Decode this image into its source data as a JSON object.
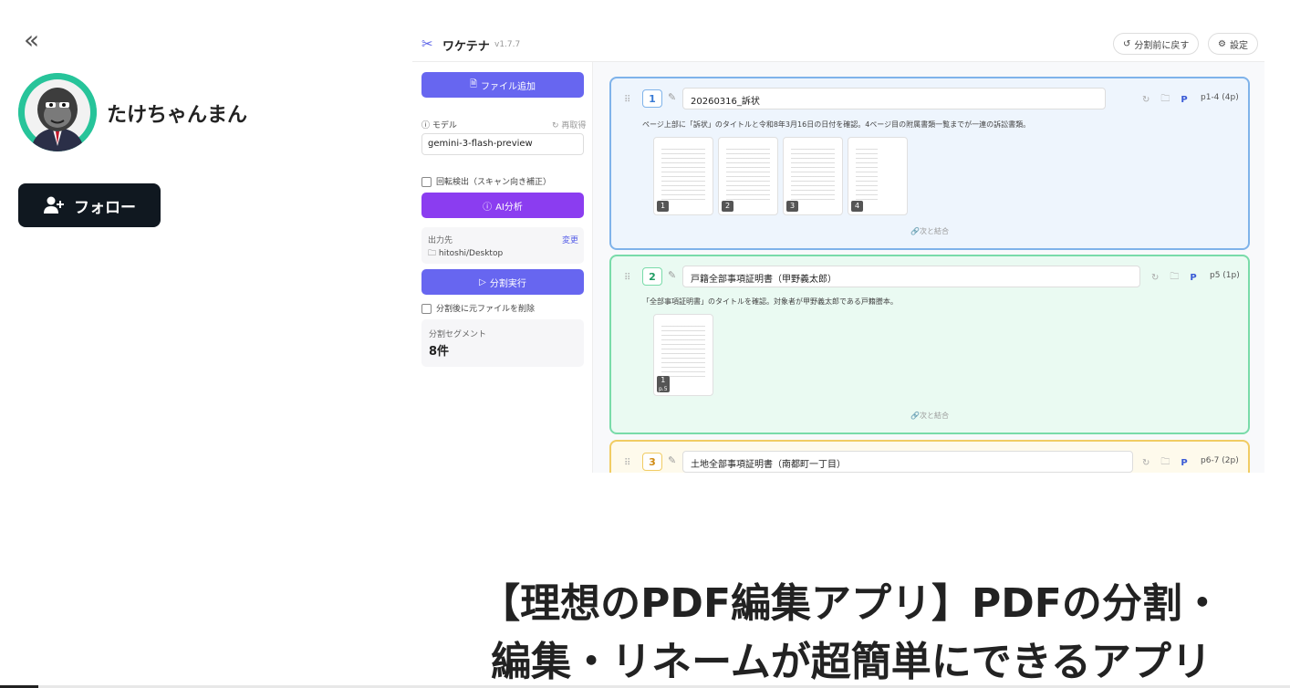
{
  "profile": {
    "collapse_glyph": "«",
    "name": "たけちゃんまん",
    "follow_label": "フォロー"
  },
  "app": {
    "name": "ワケテナ",
    "version": "v1.7.7",
    "header_buttons": {
      "undo_split": "分割前に戻す",
      "settings": "設定"
    },
    "sidebar": {
      "add_file": "ファイル追加",
      "model_label": "モデル",
      "refetch": "再取得",
      "model_value": "gemini-3-flash-preview",
      "rotation_detect": "回転検出（スキャン向き補正）",
      "ai_analyze": "AI分析",
      "output_label": "出力先",
      "output_change": "変更",
      "output_path": "hitoshi/Desktop",
      "run_split": "分割実行",
      "delete_original": "分割後に元ファイルを削除",
      "segments_label": "分割セグメント",
      "segments_count": "8件"
    },
    "segments": [
      {
        "num": "1",
        "title": "20260316_訴状",
        "p_mark": "P",
        "range": "p1-4 (4p)",
        "description": "ページ上部に「訴状」のタイトルと令和8年3月16日の日付を確認。4ページ目の附属書類一覧までが一連の訴訟書類。",
        "pages": [
          "1",
          "2",
          "3",
          "4"
        ],
        "merge_label": "次と結合",
        "color": "#7fb3ea",
        "bg": "#eef5fd"
      },
      {
        "num": "2",
        "title": "戸籍全部事項証明書（甲野義太郎）",
        "p_mark": "P",
        "range": "p5 (1p)",
        "description": "「全部事項証明書」のタイトルを確認。対象者が甲野義太郎である戸籍謄本。",
        "pages": [
          "1"
        ],
        "page_sub": "p.5",
        "merge_label": "次と結合",
        "color": "#79dba9",
        "bg": "#eafaf2"
      },
      {
        "num": "3",
        "title": "土地全部事項証明書（南都町一丁目）",
        "p_mark": "P",
        "range": "p6-7 (2p)",
        "color": "#f1cc63",
        "bg": "#fefaec"
      }
    ]
  },
  "article": {
    "title_line1": "【理想のPDF編集アプリ】PDFの分割・",
    "title_line2": "編集・リネームが超簡単にできるアプリ"
  },
  "icons": {
    "collapse": "double-chevron-left-icon",
    "follow": "add-user-icon",
    "logo": "scissors-icon",
    "undo": "undo-icon",
    "settings": "gear-icon"
  },
  "reading_progress": 0.03
}
